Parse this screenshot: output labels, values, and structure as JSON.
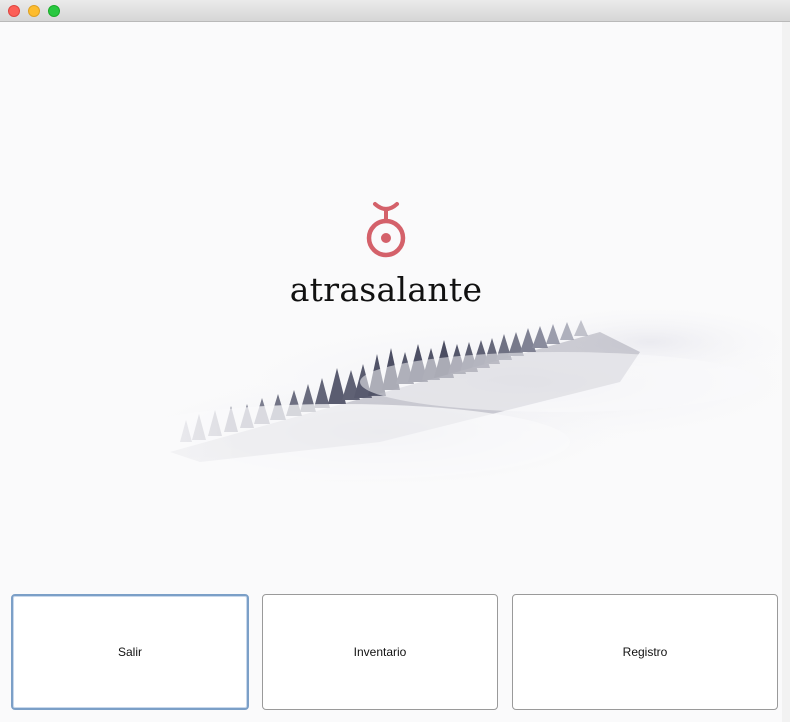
{
  "window": {
    "traffic_lights": [
      "close",
      "minimize",
      "zoom"
    ]
  },
  "brand": {
    "name": "atrasalante",
    "icon": "unicycle-logo-icon",
    "color": "#d4616a"
  },
  "background": {
    "description_icon": "foggy-forest-image"
  },
  "buttons": {
    "salir": "Salir",
    "inventario": "Inventario",
    "registro": "Registro"
  },
  "colors": {
    "focus_ring": "#7b9fc7",
    "button_border": "#9a9a9a"
  }
}
